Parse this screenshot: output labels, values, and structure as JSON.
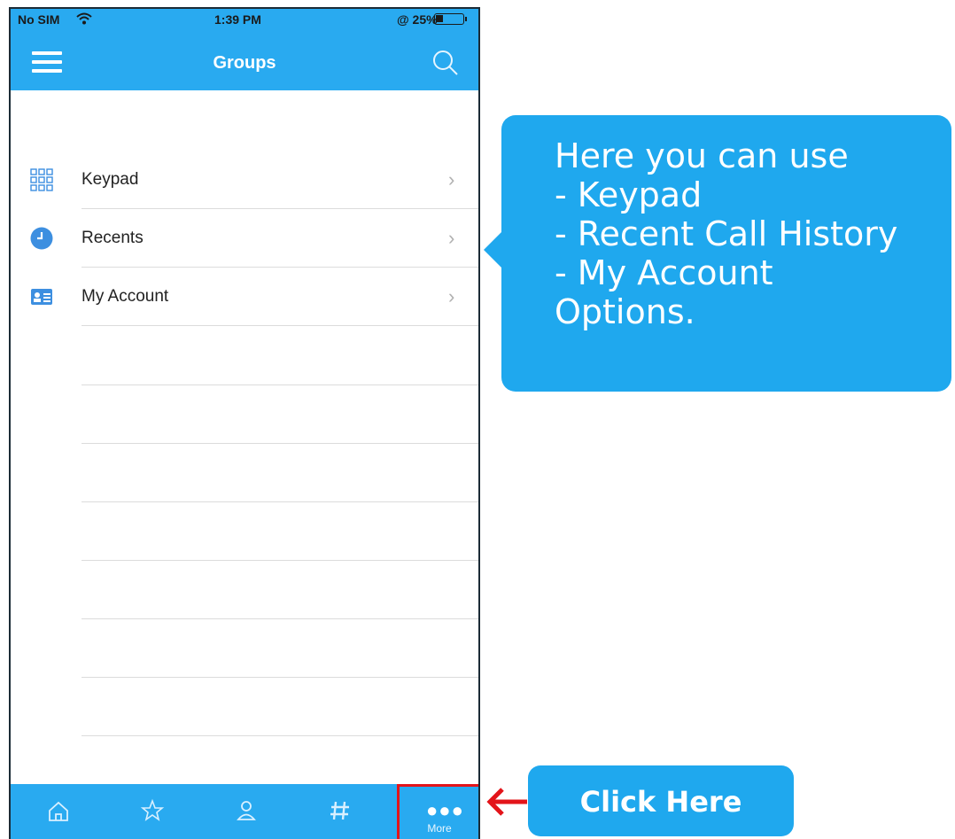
{
  "status_bar": {
    "carrier": "No SIM",
    "time": "1:39 PM",
    "battery": "@ 25%"
  },
  "header": {
    "title": "Groups"
  },
  "menu_items": [
    {
      "label": "Keypad",
      "icon": "keypad-icon"
    },
    {
      "label": "Recents",
      "icon": "clock-icon"
    },
    {
      "label": "My Account",
      "icon": "account-card-icon"
    }
  ],
  "tab_bar": {
    "tabs": [
      {
        "icon": "home-icon"
      },
      {
        "icon": "star-icon"
      },
      {
        "icon": "person-icon"
      },
      {
        "icon": "hash-icon"
      },
      {
        "icon": "more-dots-icon",
        "label": "More"
      }
    ]
  },
  "callout": {
    "lines": [
      "Here you can use",
      "- Keypad",
      "- Recent Call History",
      "- My Account",
      "Options."
    ]
  },
  "click_here": {
    "label": "Click Here"
  },
  "colors": {
    "accent": "#29aaf0",
    "bubble": "#1fa8ee",
    "highlight": "#e3141a"
  }
}
